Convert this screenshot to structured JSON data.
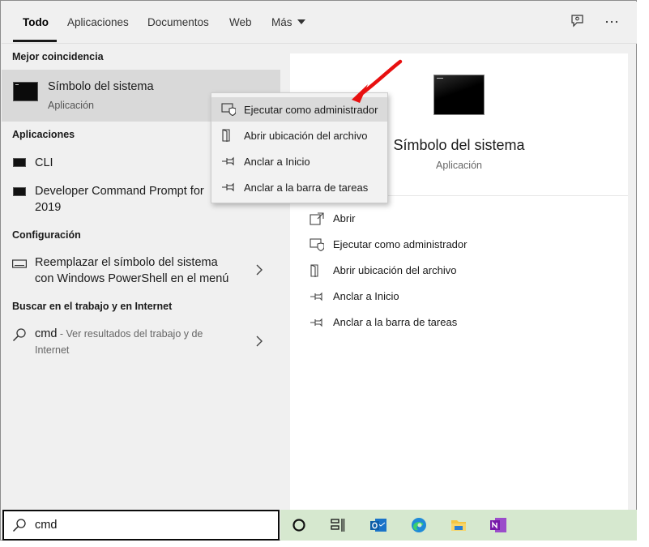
{
  "tabs": [
    {
      "label": "Todo",
      "active": true
    },
    {
      "label": "Aplicaciones"
    },
    {
      "label": "Documentos"
    },
    {
      "label": "Web"
    },
    {
      "label": "Más"
    }
  ],
  "top_icons": [
    "feedback-icon",
    "more-icon"
  ],
  "left": {
    "best_match_header": "Mejor coincidencia",
    "best_match": {
      "title": "Símbolo del sistema",
      "subtitle": "Aplicación"
    },
    "apps_header": "Aplicaciones",
    "apps": [
      {
        "label": "CLI"
      },
      {
        "label_line1": "Developer Command Prompt for",
        "label_line2": "2019"
      }
    ],
    "settings_header": "Configuración",
    "setting": {
      "line1": "Reemplazar el símbolo del sistema",
      "line2": "con Windows PowerShell en el menú"
    },
    "web_header": "Buscar en el trabajo y en Internet",
    "web": {
      "query": "cmd",
      "suffix": " - Ver resultados del trabajo y de",
      "line2": "Internet"
    }
  },
  "context_menu": [
    {
      "label": "Ejecutar como administrador",
      "icon": "shield-run-icon",
      "highlighted": true
    },
    {
      "label": "Abrir ubicación del archivo",
      "icon": "open-location-icon"
    },
    {
      "label": "Anclar a Inicio",
      "icon": "pin-icon"
    },
    {
      "label": "Anclar a la barra de tareas",
      "icon": "pin-icon"
    }
  ],
  "preview": {
    "title": "Símbolo del sistema",
    "subtitle": "Aplicación",
    "actions": [
      {
        "label": "Abrir",
        "icon": "open-icon"
      },
      {
        "label": "Ejecutar como administrador",
        "icon": "shield-run-icon"
      },
      {
        "label": "Abrir ubicación del archivo",
        "icon": "open-location-icon"
      },
      {
        "label": "Anclar a Inicio",
        "icon": "pin-icon"
      },
      {
        "label": "Anclar a la barra de tareas",
        "icon": "pin-icon"
      }
    ]
  },
  "search": {
    "value": "cmd"
  },
  "taskbar": [
    "cortana-icon",
    "task-view-icon",
    "outlook-icon",
    "edge-icon",
    "file-explorer-icon",
    "onenote-icon"
  ],
  "colors": {
    "taskbar": "#d6e8cf",
    "selection": "#d9d9d9",
    "arrow": "#e81010"
  }
}
